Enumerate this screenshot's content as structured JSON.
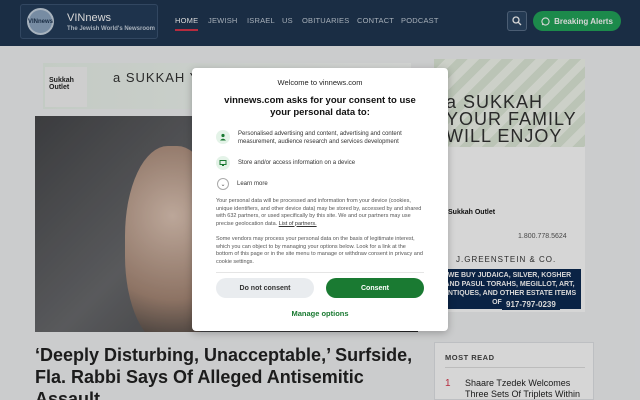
{
  "header": {
    "logo_name": "VINnews",
    "logo_tagline": "The Jewish World's Newsroom",
    "logo_badge": "VINnews",
    "nav": [
      "HOME",
      "JEWISH",
      "ISRAEL",
      "US",
      "OBITUARIES",
      "CONTACT",
      "PODCAST"
    ],
    "active_nav": "HOME",
    "alerts_label": "Breaking Alerts",
    "alerts_color": "#22a55a",
    "bar_color": "#1f3651"
  },
  "ads": {
    "top_brand": "Sukkah Outlet",
    "top_slogan": "a SUKKAH YOUR FAMILY WILL ENJOY",
    "right_slogan": "a SUKKAH YOUR FAMILY WILL ENJOY",
    "right_brand": "Sukkah Outlet",
    "right_phone": "1.800.778.5624",
    "right_company": "J.GREENSTEIN & CO.",
    "right_offer": "WE BUY JUDAICA, SILVER, KOSHER AND PASUL TORAHS, MEGILLOT, ART, ANTIQUES, AND OTHER ESTATE ITEMS OF VALUE",
    "right_phone2": "917-797-0239"
  },
  "article": {
    "headline": "‘Deeply Disturbing, Unacceptable,’ Surfside, Fla. Rabbi Says Of Alleged Antisemitic Assault"
  },
  "most_read": {
    "title": "MOST READ",
    "items": [
      {
        "num": "1",
        "text": "Shaare Tzedek Welcomes Three Sets Of Triplets Within"
      }
    ]
  },
  "consent": {
    "welcome": "Welcome to vinnews.com",
    "heading": "vinnews.com asks for your consent to use your personal data to:",
    "purposes": [
      {
        "icon": "person-icon",
        "text": "Personalised advertising and content, advertising and content measurement, audience research and services development"
      },
      {
        "icon": "device-icon",
        "text": "Store and/or access information on a device"
      }
    ],
    "learn_more": "Learn more",
    "body1": "Your personal data will be processed and information from your device (cookies, unique identifiers, and other device data) may be stored by, accessed by and shared with 632 partners, or used specifically by this site. We and our partners may use precise geolocation data.",
    "partners_link": "List of partners.",
    "body2": "Some vendors may process your personal data on the basis of legitimate interest, which you can object to by managing your options below. Look for a link at the bottom of this page or in the site menu to manage or withdraw consent in privacy and cookie settings.",
    "decline_label": "Do not consent",
    "accept_label": "Consent",
    "manage_label": "Manage options",
    "accent_color": "#1a7a32"
  }
}
